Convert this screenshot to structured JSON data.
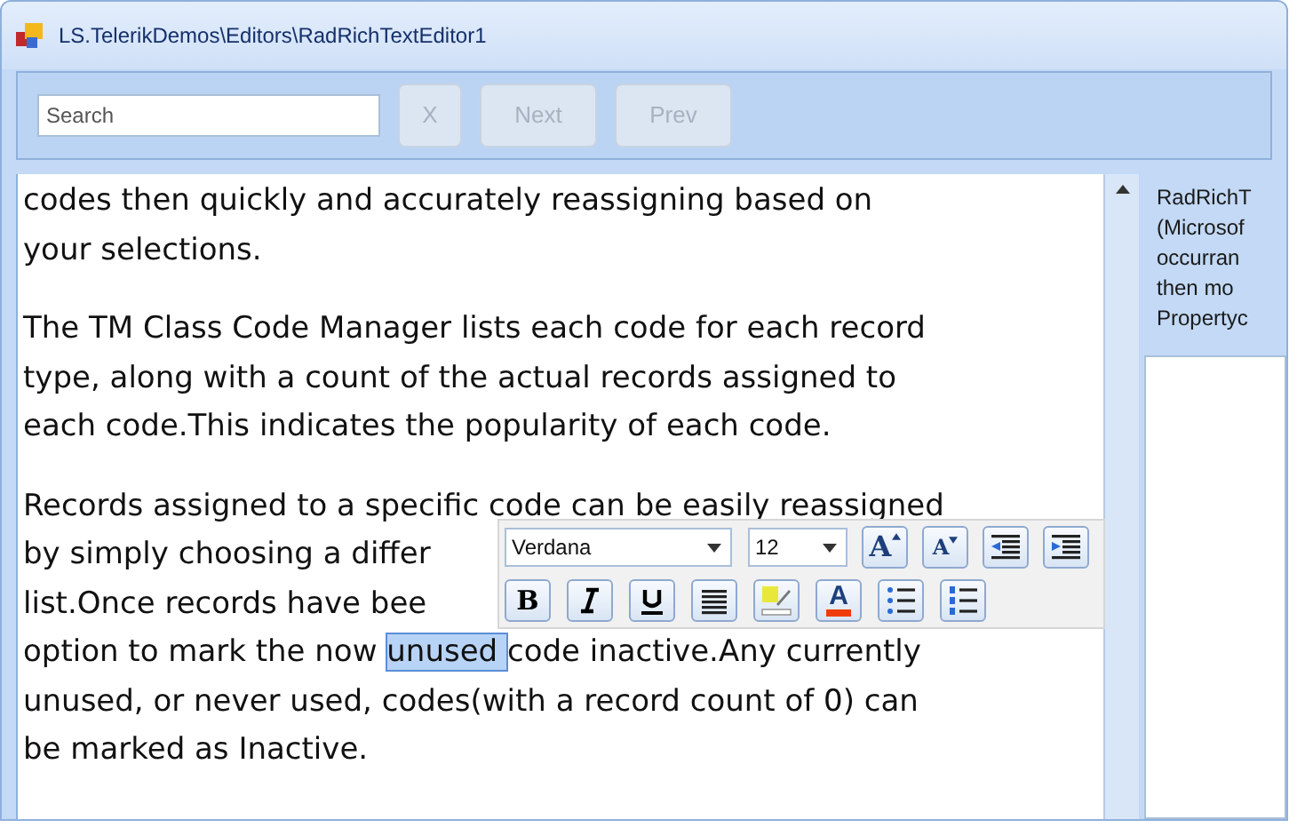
{
  "window": {
    "title": "LS.TelerikDemos\\Editors\\RadRichTextEditor1"
  },
  "search": {
    "placeholder": "Search",
    "buttons": [
      {
        "label": "X",
        "disabled": true
      },
      {
        "label": "Next",
        "disabled": true
      },
      {
        "label": "Prev",
        "disabled": true
      }
    ]
  },
  "editor": {
    "paragraphs": [
      {
        "lines": [
          [
            {
              "text": "codes then quickly and accurately reassigning based on",
              "selected": false
            }
          ],
          [
            {
              "text": "your selections.",
              "selected": false
            }
          ]
        ]
      },
      {
        "lines": [
          [
            {
              "text": "The TM Class Code Manager lists each code for each record",
              "selected": false
            }
          ],
          [
            {
              "text": "type, along with a count of the actual records assigned to",
              "selected": false
            }
          ],
          [
            {
              "text": "each code.This indicates the popularity of each code.",
              "selected": false
            }
          ]
        ]
      },
      {
        "lines": [
          [
            {
              "text": "Records assigned to a specific code can be easily reassigned",
              "selected": false
            }
          ],
          [
            {
              "text": "by simply choosing a differ",
              "selected": false
            }
          ],
          [
            {
              "text": "list.Once records have bee",
              "selected": false
            }
          ],
          [
            {
              "text": "option to mark the now ",
              "selected": false
            },
            {
              "text": "unused ",
              "selected": true
            },
            {
              "text": "code inactive.Any currently",
              "selected": false
            }
          ],
          [
            {
              "text": "unused, or never used, codes(with a record count of 0) can",
              "selected": false
            }
          ],
          [
            {
              "text": "be marked as Inactive.",
              "selected": false
            }
          ]
        ]
      }
    ]
  },
  "mini_toolbar": {
    "font": "Verdana",
    "size": "12",
    "rows": [
      [
        {
          "kind": "grow-font",
          "glyph": "A"
        },
        {
          "kind": "shrink-font",
          "glyph": "A"
        },
        {
          "kind": "outdent"
        },
        {
          "kind": "indent"
        }
      ],
      [
        {
          "kind": "bold",
          "glyph": "B"
        },
        {
          "kind": "italic"
        },
        {
          "kind": "underline"
        },
        {
          "kind": "align"
        },
        {
          "kind": "highlight"
        },
        {
          "kind": "font-color",
          "glyph": "A"
        },
        {
          "kind": "bullets"
        },
        {
          "kind": "numbering"
        }
      ]
    ]
  },
  "side_panel": {
    "lines": [
      "RadRichT",
      "(Microsof",
      "occurran",
      "then mo",
      "Propertyc"
    ]
  }
}
